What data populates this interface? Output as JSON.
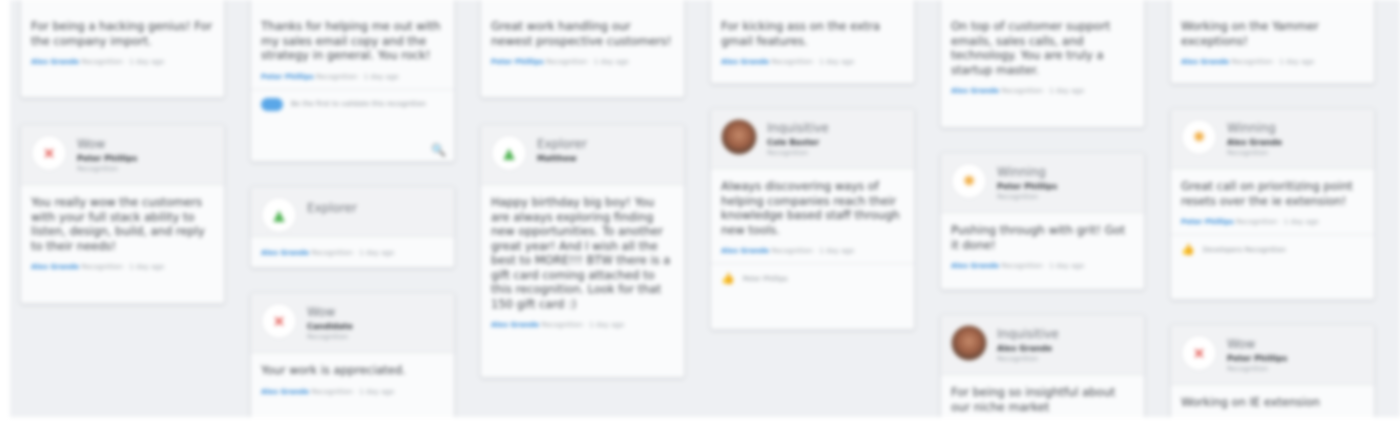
{
  "columns": [
    {
      "cards": [
        {
          "message": "For being a hacking genius! For the company import.",
          "author": "Alex Grande",
          "meta": "Recognition · 1 day ago"
        },
        {
          "award": "Wow",
          "recipient": "Peter Phillips",
          "sub": "Recognition",
          "message": "You really wow the customers with your full stack ability to listen, design, build, and reply to their needs!",
          "author": "Alex Grande",
          "meta": "Recognition · 1 day ago"
        }
      ]
    },
    {
      "cards": [
        {
          "message": "Thanks for helping me out with my sales email copy and the strategy in general. You rock!",
          "author": "Peter Phillips",
          "meta": "Recognition · 1 day ago",
          "footer": "Be the first to validate this recognition"
        },
        {
          "award": "Explorer",
          "author": "Alex Grande",
          "meta": "Recognition · 1 day ago"
        },
        {
          "award": "Wow",
          "recipient": "Candidate",
          "sub": "Recognition",
          "message": "Your work is appreciated.",
          "author": "Alex Grande",
          "meta": "Recognition · 1 day ago"
        }
      ]
    },
    {
      "cards": [
        {
          "message": "Great work handling our newest prospective customers!",
          "author": "Peter Phillips",
          "meta": "Recognition · 1 day ago"
        },
        {
          "award": "Explorer",
          "recipient": "Matthew",
          "message": "Happy birthday big boy! You are always exploring finding new opportunities. To another great year! And I wish all the best to MORE!!! BTW there is a gift card coming attached to this recognition. Look for that 150 gift card :)",
          "author": "Alex Grande",
          "meta": "Recognition · 1 day ago"
        }
      ]
    },
    {
      "cards": [
        {
          "message": "For kicking ass on the extra gmail features.",
          "author": "Alex Grande",
          "meta": "Recognition · 1 day ago"
        },
        {
          "award": "Inquisitive",
          "recipient": "Cole Baxter",
          "sub": "Recognition",
          "message": "Always discovering ways of helping companies reach their knowledge based staff through new tools.",
          "author": "Alex Grande",
          "meta": "Recognition · 1 day ago",
          "footer": "Peter Phillips"
        }
      ]
    },
    {
      "cards": [
        {
          "message": "On top of customer support emails, sales calls, and technology. You are truly a startup master.",
          "author": "Alex Grande",
          "meta": "Recognition · 1 day ago"
        },
        {
          "award": "Winning",
          "recipient": "Peter Phillips",
          "sub": "Recognition",
          "message": "Pushing through with grit! Got it done!",
          "author": "Alex Grande",
          "meta": "Recognition · 1 day ago"
        },
        {
          "award": "Inquisitive",
          "recipient": "Alex Grande",
          "sub": "Recognition",
          "message": "For being so insightful about our niche market"
        }
      ]
    },
    {
      "cards": [
        {
          "message": "Working on the Yammer exceptions!",
          "author": "Alex Grande",
          "meta": "Recognition · 1 day ago"
        },
        {
          "award": "Winning",
          "recipient": "Alex Grande",
          "sub": "Recognition",
          "message": "Great call on prioritizing point resets over the ie extension!",
          "author": "Peter Phillips",
          "meta": "Recognition · 1 day ago",
          "footer": "Developers Recognition"
        },
        {
          "award": "Wow",
          "recipient": "Peter Phillips",
          "sub": "Recognition",
          "message": "Working on IE extension"
        }
      ]
    }
  ],
  "icons": {
    "wow": "×",
    "explorer": "▲",
    "winning": "✺",
    "like": "👍",
    "tool": "🔍"
  },
  "colors": {
    "link": "#3b8fd9",
    "background": "#eef0f3",
    "pill": "#5aa7e8"
  }
}
